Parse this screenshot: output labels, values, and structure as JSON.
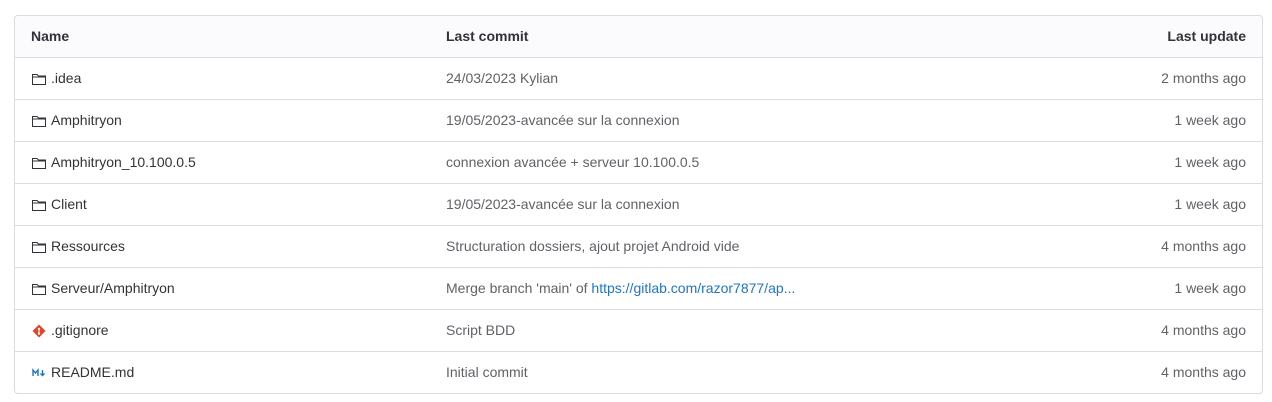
{
  "header": {
    "name": "Name",
    "last_commit": "Last commit",
    "last_update": "Last update"
  },
  "rows": [
    {
      "icon": "folder-icon",
      "name": ".idea",
      "commit": "24/03/2023 Kylian",
      "commit_link": "",
      "update": "2 months ago"
    },
    {
      "icon": "folder-icon",
      "name": "Amphitryon",
      "commit": "19/05/2023-avancée sur la connexion",
      "commit_link": "",
      "update": "1 week ago"
    },
    {
      "icon": "folder-icon",
      "name": "Amphitryon_10.100.0.5",
      "commit": "connexion avancée + serveur 10.100.0.5",
      "commit_link": "",
      "update": "1 week ago"
    },
    {
      "icon": "folder-icon",
      "name": "Client",
      "commit": "19/05/2023-avancée sur la connexion",
      "commit_link": "",
      "update": "1 week ago"
    },
    {
      "icon": "folder-icon",
      "name": "Ressources",
      "commit": "Structuration dossiers, ajout projet Android vide",
      "commit_link": "",
      "update": "4 months ago"
    },
    {
      "icon": "folder-icon",
      "name": "Serveur/Amphitryon",
      "commit": "Merge branch 'main' of ",
      "commit_link": "https://gitlab.com/razor7877/ap...",
      "update": "1 week ago"
    },
    {
      "icon": "git-icon",
      "name": ".gitignore",
      "commit": "Script BDD",
      "commit_link": "",
      "update": "4 months ago"
    },
    {
      "icon": "markdown-icon",
      "name": "README.md",
      "commit": "Initial commit",
      "commit_link": "",
      "update": "4 months ago"
    }
  ],
  "colors": {
    "border": "#dcdcde",
    "header_bg": "#fbfafd",
    "link": "#1f75cb",
    "git_icon": "#e24329",
    "markdown_icon": "#1f75cb"
  }
}
